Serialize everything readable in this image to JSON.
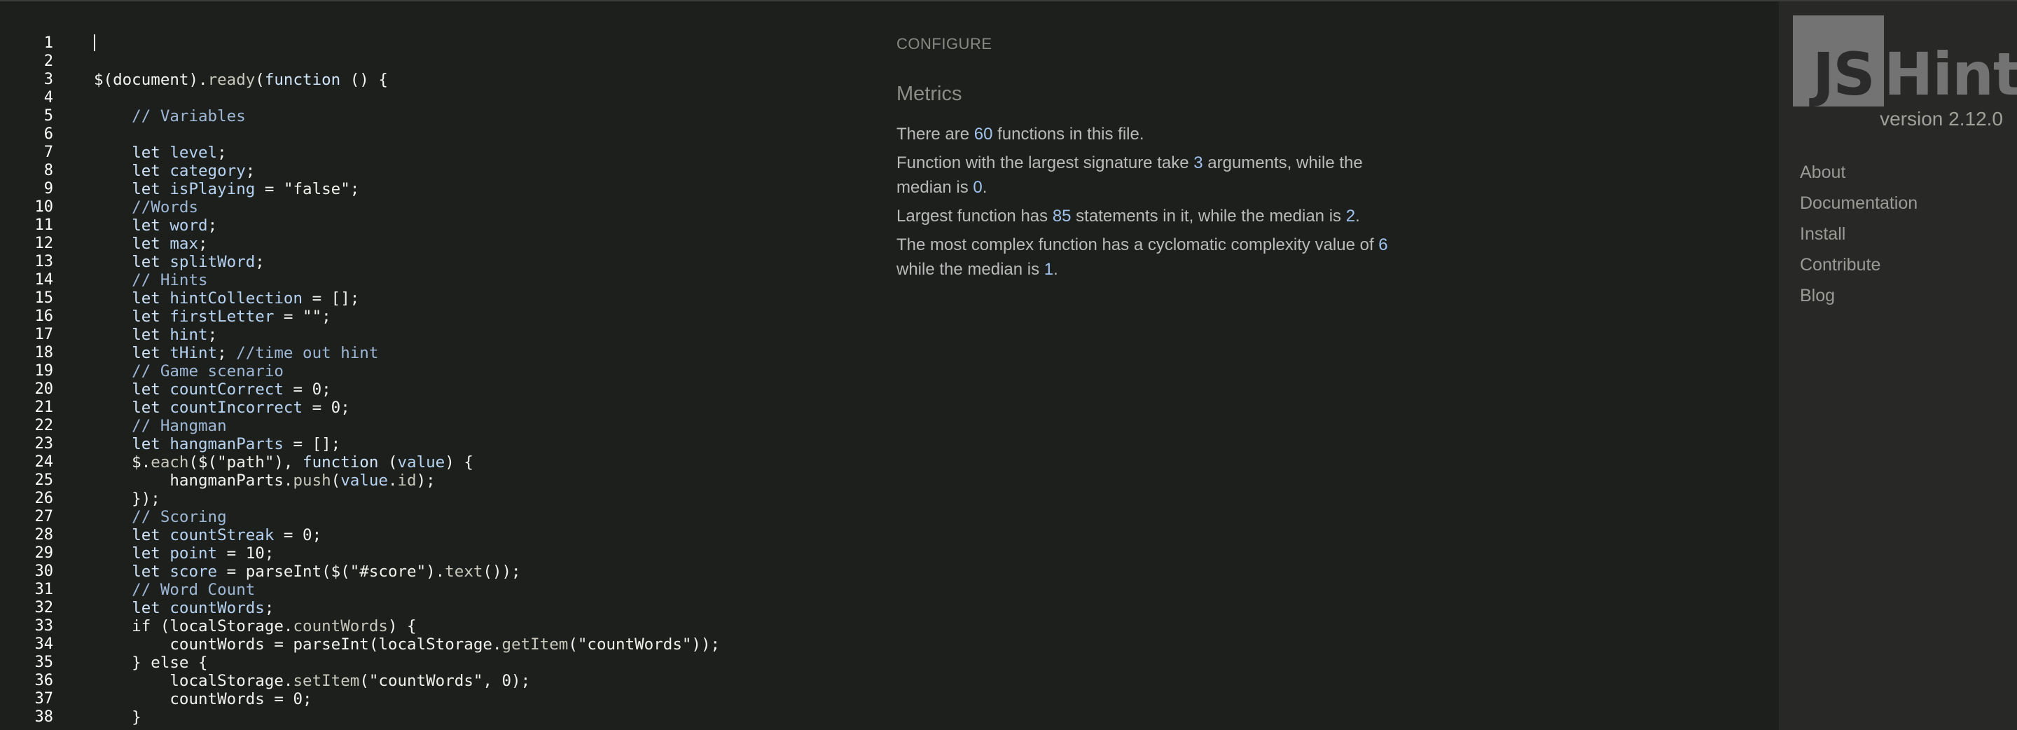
{
  "editor": {
    "line_numbers": [
      "1",
      "2",
      "3",
      "4",
      "5",
      "6",
      "7",
      "8",
      "9",
      "10",
      "11",
      "12",
      "13",
      "14",
      "15",
      "16",
      "17",
      "18",
      "19",
      "20",
      "21",
      "22",
      "23",
      "24",
      "25",
      "26",
      "27",
      "28",
      "29",
      "30",
      "31",
      "32",
      "33",
      "34",
      "35",
      "36",
      "37",
      "38"
    ],
    "lines": [
      [],
      [],
      [
        [
          "p",
          "$(document)."
        ],
        [
          "prop",
          "ready"
        ],
        [
          "p",
          "("
        ],
        [
          "k",
          "function"
        ],
        [
          "p",
          " () {"
        ]
      ],
      [],
      [
        [
          "c",
          "    // Variables"
        ]
      ],
      [],
      [
        [
          "p",
          "    "
        ],
        [
          "k",
          "let"
        ],
        [
          "p",
          " "
        ],
        [
          "v",
          "level"
        ],
        [
          "p",
          ";"
        ]
      ],
      [
        [
          "p",
          "    "
        ],
        [
          "k",
          "let"
        ],
        [
          "p",
          " "
        ],
        [
          "v",
          "category"
        ],
        [
          "p",
          ";"
        ]
      ],
      [
        [
          "p",
          "    "
        ],
        [
          "k",
          "let"
        ],
        [
          "p",
          " "
        ],
        [
          "v",
          "isPlaying"
        ],
        [
          "p",
          " = "
        ],
        [
          "s",
          "\"false\""
        ],
        [
          "p",
          ";"
        ]
      ],
      [
        [
          "c",
          "    //Words"
        ]
      ],
      [
        [
          "p",
          "    "
        ],
        [
          "k",
          "let"
        ],
        [
          "p",
          " "
        ],
        [
          "v",
          "word"
        ],
        [
          "p",
          ";"
        ]
      ],
      [
        [
          "p",
          "    "
        ],
        [
          "k",
          "let"
        ],
        [
          "p",
          " "
        ],
        [
          "v",
          "max"
        ],
        [
          "p",
          ";"
        ]
      ],
      [
        [
          "p",
          "    "
        ],
        [
          "k",
          "let"
        ],
        [
          "p",
          " "
        ],
        [
          "v",
          "splitWord"
        ],
        [
          "p",
          ";"
        ]
      ],
      [
        [
          "c",
          "    // Hints"
        ]
      ],
      [
        [
          "p",
          "    "
        ],
        [
          "k",
          "let"
        ],
        [
          "p",
          " "
        ],
        [
          "v",
          "hintCollection"
        ],
        [
          "p",
          " = []"
        ],
        [
          "p",
          ";"
        ]
      ],
      [
        [
          "p",
          "    "
        ],
        [
          "k",
          "let"
        ],
        [
          "p",
          " "
        ],
        [
          "v",
          "firstLetter"
        ],
        [
          "p",
          " = "
        ],
        [
          "s",
          "\"\""
        ],
        [
          "p",
          ";"
        ]
      ],
      [
        [
          "p",
          "    "
        ],
        [
          "k",
          "let"
        ],
        [
          "p",
          " "
        ],
        [
          "v",
          "hint"
        ],
        [
          "p",
          ";"
        ]
      ],
      [
        [
          "p",
          "    "
        ],
        [
          "k",
          "let"
        ],
        [
          "p",
          " "
        ],
        [
          "v",
          "tHint"
        ],
        [
          "p",
          "; "
        ],
        [
          "c",
          "//time out hint"
        ]
      ],
      [
        [
          "c",
          "    // Game scenario"
        ]
      ],
      [
        [
          "p",
          "    "
        ],
        [
          "k",
          "let"
        ],
        [
          "p",
          " "
        ],
        [
          "v",
          "countCorrect"
        ],
        [
          "p",
          " = 0;"
        ]
      ],
      [
        [
          "p",
          "    "
        ],
        [
          "k",
          "let"
        ],
        [
          "p",
          " "
        ],
        [
          "v",
          "countIncorrect"
        ],
        [
          "p",
          " = 0;"
        ]
      ],
      [
        [
          "c",
          "    // Hangman"
        ]
      ],
      [
        [
          "p",
          "    "
        ],
        [
          "k",
          "let"
        ],
        [
          "p",
          " "
        ],
        [
          "v",
          "hangmanParts"
        ],
        [
          "p",
          " = []"
        ],
        [
          "p",
          ";"
        ]
      ],
      [
        [
          "p",
          "    $."
        ],
        [
          "prop",
          "each"
        ],
        [
          "p",
          "($("
        ],
        [
          "s",
          "\"path\""
        ],
        [
          "p",
          "), "
        ],
        [
          "k",
          "function"
        ],
        [
          "p",
          " ("
        ],
        [
          "v",
          "value"
        ],
        [
          "p",
          ") {"
        ]
      ],
      [
        [
          "p",
          "        hangmanParts."
        ],
        [
          "prop",
          "push"
        ],
        [
          "p",
          "("
        ],
        [
          "v",
          "value"
        ],
        [
          "p",
          "."
        ],
        [
          "prop",
          "id"
        ],
        [
          "p",
          ");"
        ]
      ],
      [
        [
          "p",
          "    });"
        ]
      ],
      [
        [
          "c",
          "    // Scoring"
        ]
      ],
      [
        [
          "p",
          "    "
        ],
        [
          "k",
          "let"
        ],
        [
          "p",
          " "
        ],
        [
          "v",
          "countStreak"
        ],
        [
          "p",
          " = 0;"
        ]
      ],
      [
        [
          "p",
          "    "
        ],
        [
          "k",
          "let"
        ],
        [
          "p",
          " "
        ],
        [
          "v",
          "point"
        ],
        [
          "p",
          " = 10;"
        ]
      ],
      [
        [
          "p",
          "    "
        ],
        [
          "k",
          "let"
        ],
        [
          "p",
          " "
        ],
        [
          "v",
          "score"
        ],
        [
          "p",
          " = parseInt($("
        ],
        [
          "s",
          "\"#score\""
        ],
        [
          "p",
          ")."
        ],
        [
          "prop",
          "text"
        ],
        [
          "p",
          "());"
        ]
      ],
      [
        [
          "c",
          "    // Word Count"
        ]
      ],
      [
        [
          "p",
          "    "
        ],
        [
          "k",
          "let"
        ],
        [
          "p",
          " "
        ],
        [
          "v",
          "countWords"
        ],
        [
          "p",
          ";"
        ]
      ],
      [
        [
          "p",
          "    if (localStorage."
        ],
        [
          "prop",
          "countWords"
        ],
        [
          "p",
          ") {"
        ]
      ],
      [
        [
          "p",
          "        countWords = parseInt(localStorage."
        ],
        [
          "prop",
          "getItem"
        ],
        [
          "p",
          "("
        ],
        [
          "s",
          "\"countWords\""
        ],
        [
          "p",
          "));"
        ]
      ],
      [
        [
          "p",
          "    } else {"
        ]
      ],
      [
        [
          "p",
          "        localStorage."
        ],
        [
          "prop",
          "setItem"
        ],
        [
          "p",
          "("
        ],
        [
          "s",
          "\"countWords\""
        ],
        [
          "p",
          ", 0);"
        ]
      ],
      [
        [
          "p",
          "        countWords = 0;"
        ]
      ],
      [
        [
          "p",
          "    }"
        ]
      ]
    ]
  },
  "report": {
    "configure_label": "CONFIGURE",
    "metrics_title": "Metrics",
    "metrics": {
      "functions_pre": "There are ",
      "functions_count": "60",
      "functions_post": " functions in this file.",
      "signature_pre": "Function with the largest signature take ",
      "signature_count": "3",
      "signature_mid": " arguments, while the median is ",
      "signature_median": "0",
      "signature_post": ".",
      "largest_pre": "Largest function has ",
      "largest_count": "85",
      "largest_mid": " statements in it, while the median is ",
      "largest_median": "2",
      "largest_post": ".",
      "complex_pre": "The most complex function has a cyclomatic complexity value of ",
      "complex_value": "6",
      "complex_mid": " while the median is ",
      "complex_median": "1",
      "complex_post": "."
    }
  },
  "sidebar": {
    "logo_js": "JS",
    "logo_hint": "Hint",
    "version": "version 2.12.0",
    "nav": [
      {
        "label": "About"
      },
      {
        "label": "Documentation"
      },
      {
        "label": "Install"
      },
      {
        "label": "Contribute"
      },
      {
        "label": "Blog"
      }
    ]
  }
}
